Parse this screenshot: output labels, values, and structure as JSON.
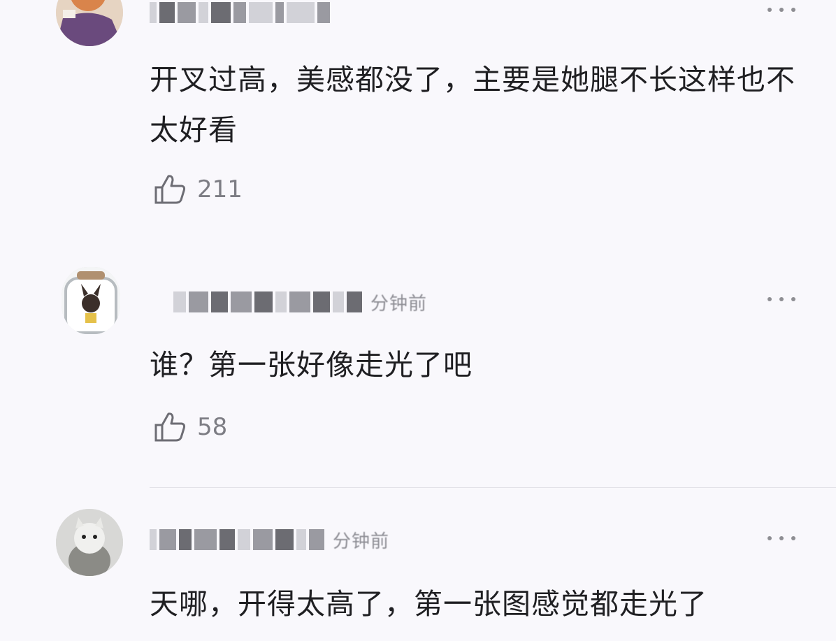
{
  "comments": [
    {
      "username": "",
      "time": "",
      "text": "开叉过高，美感都没了，主要是她腿不长这样也不太好看",
      "likes": "211"
    },
    {
      "username": "",
      "time": "分钟前",
      "text": "谁？第一张好像走光了吧",
      "likes": "58"
    },
    {
      "username": "",
      "time": "分钟前",
      "text": "天哪，开得太高了，第一张图感觉都走光了",
      "likes": ""
    }
  ],
  "icons": {
    "like": "thumbs-up-icon",
    "more": "more-options-icon"
  },
  "colors": {
    "background": "#f9f8fc",
    "text": "#1f1f22",
    "muted": "#7d7d84"
  }
}
